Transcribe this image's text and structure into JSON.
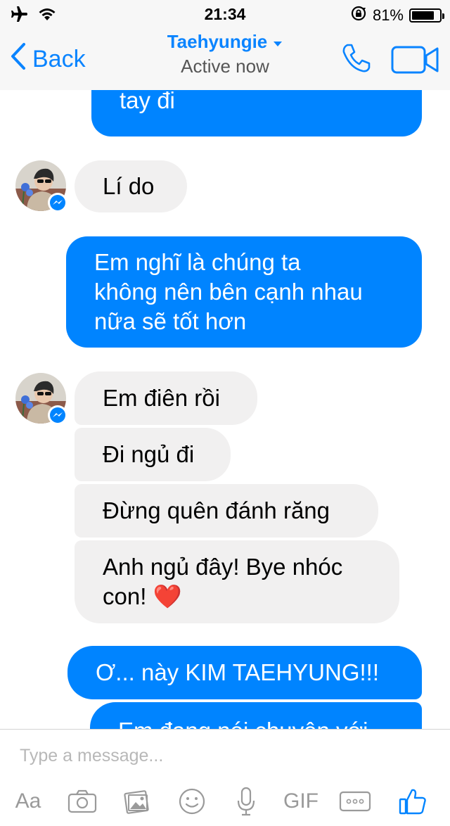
{
  "status_bar": {
    "time": "21:34",
    "battery_text": "81%",
    "battery_level": 0.81
  },
  "header": {
    "back_label": "Back",
    "contact_name": "Taehyungie",
    "status": "Active now"
  },
  "messages": [
    {
      "direction": "out",
      "lines": [
        "tay đi"
      ]
    },
    {
      "direction": "in",
      "lines": [
        "Lí do"
      ]
    },
    {
      "direction": "out",
      "lines": [
        "Em nghĩ là chúng ta",
        "không nên bên cạnh nhau",
        "nữa sẽ tốt hơn"
      ]
    },
    {
      "direction": "in",
      "lines": [
        "Em điên rồi"
      ]
    },
    {
      "direction": "in",
      "lines": [
        "Đi ngủ đi"
      ]
    },
    {
      "direction": "in",
      "lines": [
        "Đừng quên đánh răng"
      ]
    },
    {
      "direction": "in",
      "lines": [
        "Anh ngủ đây! Bye nhóc",
        "con! ❤️"
      ]
    },
    {
      "direction": "out",
      "lines": [
        "Ơ... này KIM TAEHYUNG!!!"
      ]
    },
    {
      "direction": "out",
      "lines": [
        "Em đang nói chuyện với"
      ]
    }
  ],
  "composer": {
    "placeholder": "Type a message...",
    "text_tool": "Aa",
    "gif_tool": "GIF"
  },
  "icons": {
    "airplane": "airplane-icon",
    "wifi": "wifi-icon",
    "rotation_lock": "rotation-lock-icon",
    "phone": "phone-icon",
    "video": "video-camera-icon",
    "camera": "camera-icon",
    "gallery": "gallery-icon",
    "emoji": "emoji-icon",
    "mic": "microphone-icon",
    "more": "more-icon",
    "like": "thumbs-up-icon",
    "messenger_badge": "messenger-icon"
  },
  "colors": {
    "accent": "#0084ff",
    "incoming_bubble": "#f1f0f0",
    "heart": "#e0232e"
  }
}
